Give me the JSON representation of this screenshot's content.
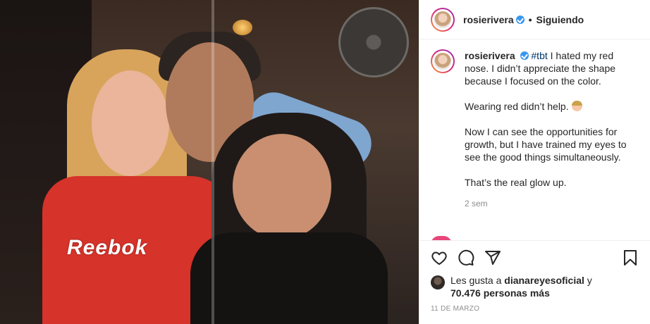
{
  "photo": {
    "shirt_text": "Reebok"
  },
  "header": {
    "username": "rosierivera",
    "separator": "•",
    "follow_status": "Siguiendo"
  },
  "caption": {
    "username": "rosierivera",
    "hashtag": "#tbt",
    "line1": "I hated my red nose. I didn’t appreciate the shape because I focused on the color.",
    "line2": "Wearing red didn’t help.",
    "line3": "Now I can see the opportunities for growth, but I have trained my eyes to see the good things simultaneously.",
    "line4": "That’s the real glow up.",
    "time_ago": "2 sem"
  },
  "likes": {
    "prefix": "Les gusta a",
    "liker": "dianareyesoficial",
    "connector": "y",
    "count_text": "70.476 personas más"
  },
  "date": "11 DE MARZO",
  "colors": {
    "verified": "#3897f0",
    "hashtag": "#00376b",
    "muted": "#8e8e8e"
  }
}
